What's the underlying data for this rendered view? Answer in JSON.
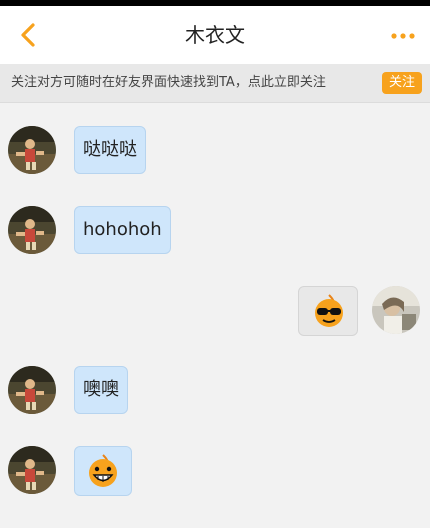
{
  "header": {
    "title": "木衣文",
    "back_icon": "back-chevron-icon",
    "more_icon": "more-dots-icon"
  },
  "notice": {
    "text": "关注对方可随时在好友界面快速找到TA，点此立即关注",
    "follow_label": "关注"
  },
  "messages": [
    {
      "sender": "other",
      "type": "text",
      "text": "哒哒哒"
    },
    {
      "sender": "other",
      "type": "text",
      "text": "hohohoh"
    },
    {
      "sender": "me",
      "type": "sticker",
      "icon": "sunglasses-face-sticker-icon"
    },
    {
      "sender": "other",
      "type": "text",
      "text": "噢噢"
    },
    {
      "sender": "other",
      "type": "sticker",
      "icon": "grinning-face-sticker-icon"
    }
  ],
  "colors": {
    "accent": "#f7a21d",
    "incoming_bubble": "#cfe6fb",
    "outgoing_bubble": "#e8e8e8"
  }
}
